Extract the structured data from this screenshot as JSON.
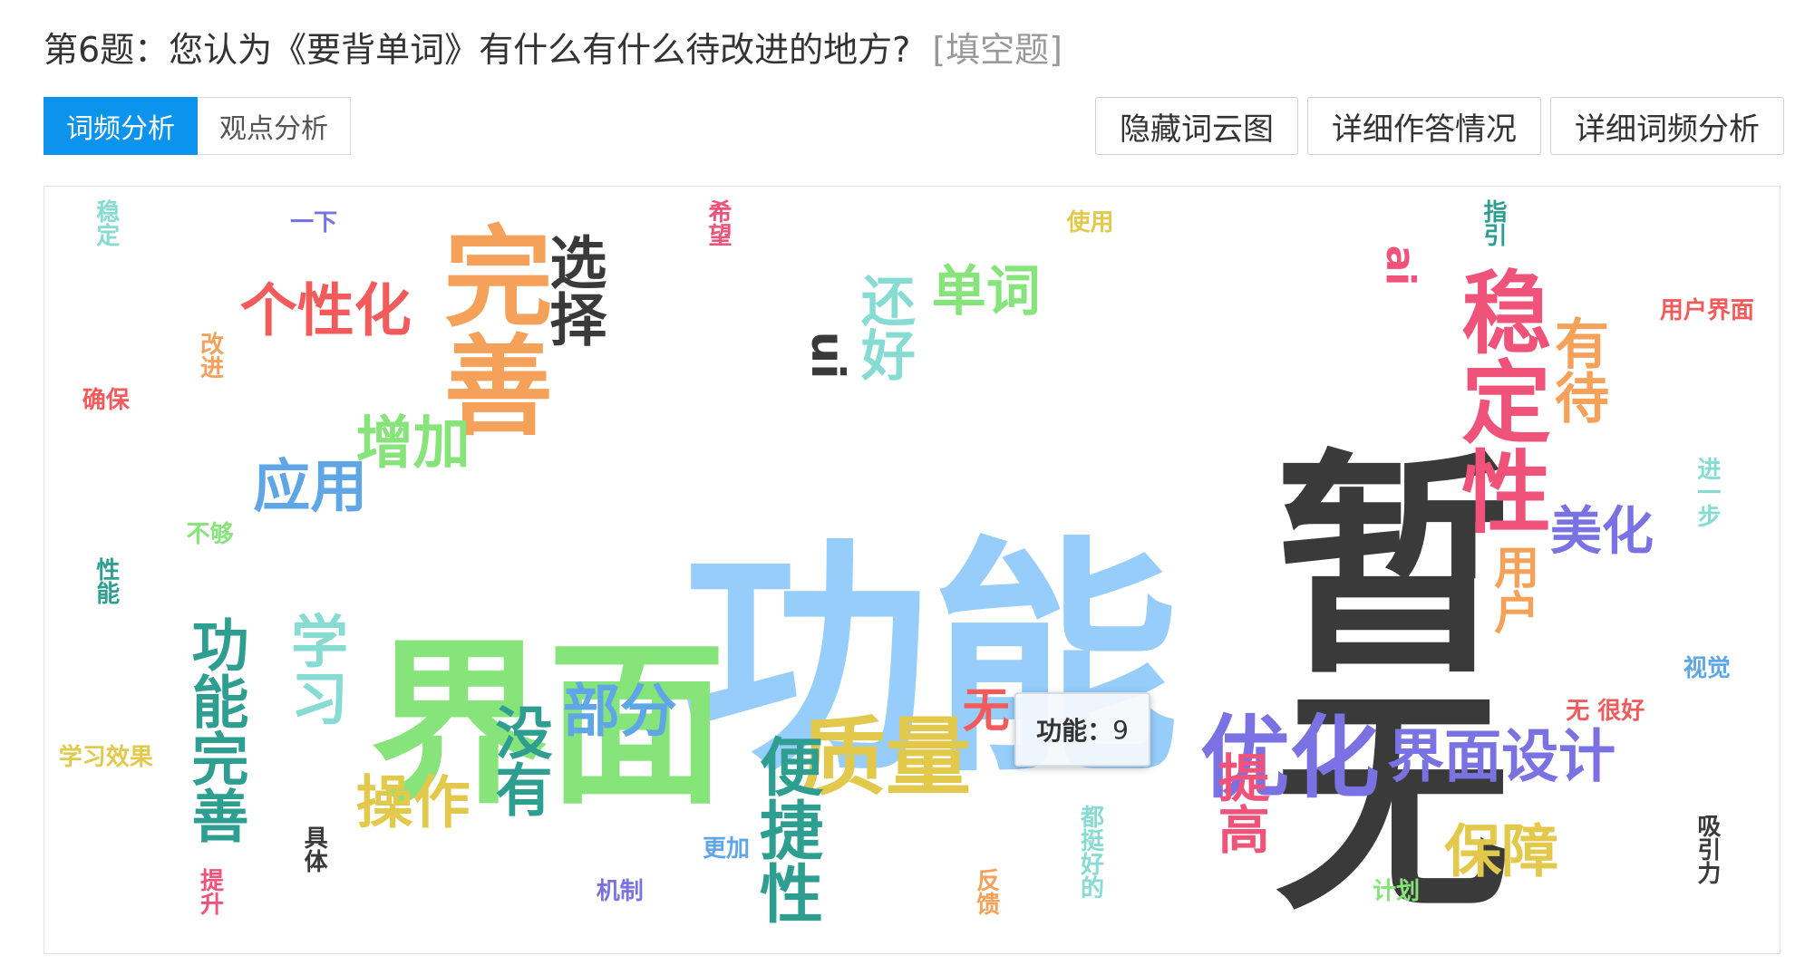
{
  "question": {
    "title": "第6题：您认为《要背单词》有什么有什么待改进的地方?",
    "type": "[填空题]"
  },
  "tabs": [
    {
      "label": "词频分析",
      "active": true
    },
    {
      "label": "观点分析",
      "active": false
    }
  ],
  "actions": {
    "hide_cloud": "隐藏词云图",
    "detail_answers": "详细作答情况",
    "detail_freq": "详细词频分析"
  },
  "tooltip": {
    "label": "功能：",
    "value": "9"
  },
  "colors": {
    "accent": "#0c93ee",
    "palette": [
      "#96cdfb",
      "#3a3a3a",
      "#87e47b",
      "#f5a15a",
      "#f0537a",
      "#7a72e2",
      "#2e9e90",
      "#e3c94b",
      "#5ea6e6",
      "#f15b5b",
      "#86dcd2"
    ]
  },
  "word_cloud": [
    {
      "text": "功能",
      "weight": 9,
      "color": "#96cdfb",
      "vertical": false
    },
    {
      "text": "暂无",
      "weight": 8,
      "color": "#3a3a3a",
      "vertical": true
    },
    {
      "text": "界面",
      "weight": 7,
      "color": "#87e47b",
      "vertical": false
    },
    {
      "text": "完善",
      "weight": 5,
      "color": "#f5a15a",
      "vertical": true
    },
    {
      "text": "稳定性",
      "weight": 4,
      "color": "#f0537a",
      "vertical": true
    },
    {
      "text": "优化",
      "weight": 4,
      "color": "#7a72e2",
      "vertical": false
    },
    {
      "text": "质量",
      "weight": 4,
      "color": "#e3c94b",
      "vertical": false
    },
    {
      "text": "便捷性",
      "weight": 3,
      "color": "#2e9e90",
      "vertical": true
    },
    {
      "text": "个性化",
      "weight": 3,
      "color": "#f15b5b",
      "vertical": false
    },
    {
      "text": "选择",
      "weight": 3,
      "color": "#3a3a3a",
      "vertical": true
    },
    {
      "text": "单词",
      "weight": 3,
      "color": "#87e47b",
      "vertical": false
    },
    {
      "text": "还好",
      "weight": 3,
      "color": "#86dcd2",
      "vertical": true
    },
    {
      "text": "有待",
      "weight": 3,
      "color": "#f5a15a",
      "vertical": true
    },
    {
      "text": "界面设计",
      "weight": 3,
      "color": "#7a72e2",
      "vertical": false
    },
    {
      "text": "功能完善",
      "weight": 3,
      "color": "#2e9e90",
      "vertical": true
    },
    {
      "text": "增加",
      "weight": 3,
      "color": "#87e47b",
      "vertical": false
    },
    {
      "text": "应用",
      "weight": 3,
      "color": "#5ea6e6",
      "vertical": false
    },
    {
      "text": "部分",
      "weight": 3,
      "color": "#5ea6e6",
      "vertical": false
    },
    {
      "text": "没有",
      "weight": 3,
      "color": "#2e9e90",
      "vertical": true
    },
    {
      "text": "操作",
      "weight": 3,
      "color": "#e3c94b",
      "vertical": false
    },
    {
      "text": "学习",
      "weight": 3,
      "color": "#86dcd2",
      "vertical": true
    },
    {
      "text": "提高",
      "weight": 3,
      "color": "#f0537a",
      "vertical": true
    },
    {
      "text": "保障",
      "weight": 3,
      "color": "#e3c94b",
      "vertical": false
    },
    {
      "text": "美化",
      "weight": 3,
      "color": "#7a72e2",
      "vertical": false
    },
    {
      "text": "用户",
      "weight": 2,
      "color": "#f5a15a",
      "vertical": true
    },
    {
      "text": "无",
      "weight": 2,
      "color": "#f15b5b",
      "vertical": false
    },
    {
      "text": "ui",
      "weight": 2,
      "color": "#3a3a3a",
      "vertical": true
    },
    {
      "text": "ai",
      "weight": 2,
      "color": "#f0537a",
      "vertical": true
    },
    {
      "text": "稳定",
      "weight": 1,
      "color": "#86dcd2",
      "vertical": true
    },
    {
      "text": "一下",
      "weight": 1,
      "color": "#7a72e2",
      "vertical": false
    },
    {
      "text": "希望",
      "weight": 1,
      "color": "#f0537a",
      "vertical": true
    },
    {
      "text": "使用",
      "weight": 1,
      "color": "#e3c94b",
      "vertical": false
    },
    {
      "text": "指引",
      "weight": 1,
      "color": "#2e9e90",
      "vertical": true
    },
    {
      "text": "用户界面",
      "weight": 1,
      "color": "#f15b5b",
      "vertical": false
    },
    {
      "text": "改进",
      "weight": 1,
      "color": "#f5a15a",
      "vertical": true
    },
    {
      "text": "确保",
      "weight": 1,
      "color": "#f15b5b",
      "vertical": false
    },
    {
      "text": "不够",
      "weight": 1,
      "color": "#87e47b",
      "vertical": false
    },
    {
      "text": "性能",
      "weight": 1,
      "color": "#2e9e90",
      "vertical": true
    },
    {
      "text": "进一步",
      "weight": 1,
      "color": "#86dcd2",
      "vertical": true
    },
    {
      "text": "视觉",
      "weight": 1,
      "color": "#5ea6e6",
      "vertical": false
    },
    {
      "text": "无 很好",
      "weight": 1,
      "color": "#f15b5b",
      "vertical": false
    },
    {
      "text": "学习效果",
      "weight": 1,
      "color": "#e3c94b",
      "vertical": false
    },
    {
      "text": "具体",
      "weight": 1,
      "color": "#3a3a3a",
      "vertical": true
    },
    {
      "text": "更加",
      "weight": 1,
      "color": "#5ea6e6",
      "vertical": false
    },
    {
      "text": "机制",
      "weight": 1,
      "color": "#7a72e2",
      "vertical": false
    },
    {
      "text": "提升",
      "weight": 1,
      "color": "#f0537a",
      "vertical": true
    },
    {
      "text": "反馈",
      "weight": 1,
      "color": "#f5a15a",
      "vertical": true
    },
    {
      "text": "都挺好的",
      "weight": 1,
      "color": "#86dcd2",
      "vertical": true
    },
    {
      "text": "计划",
      "weight": 1,
      "color": "#87e47b",
      "vertical": false
    },
    {
      "text": "吸引力",
      "weight": 1,
      "color": "#3a3a3a",
      "vertical": true
    }
  ]
}
